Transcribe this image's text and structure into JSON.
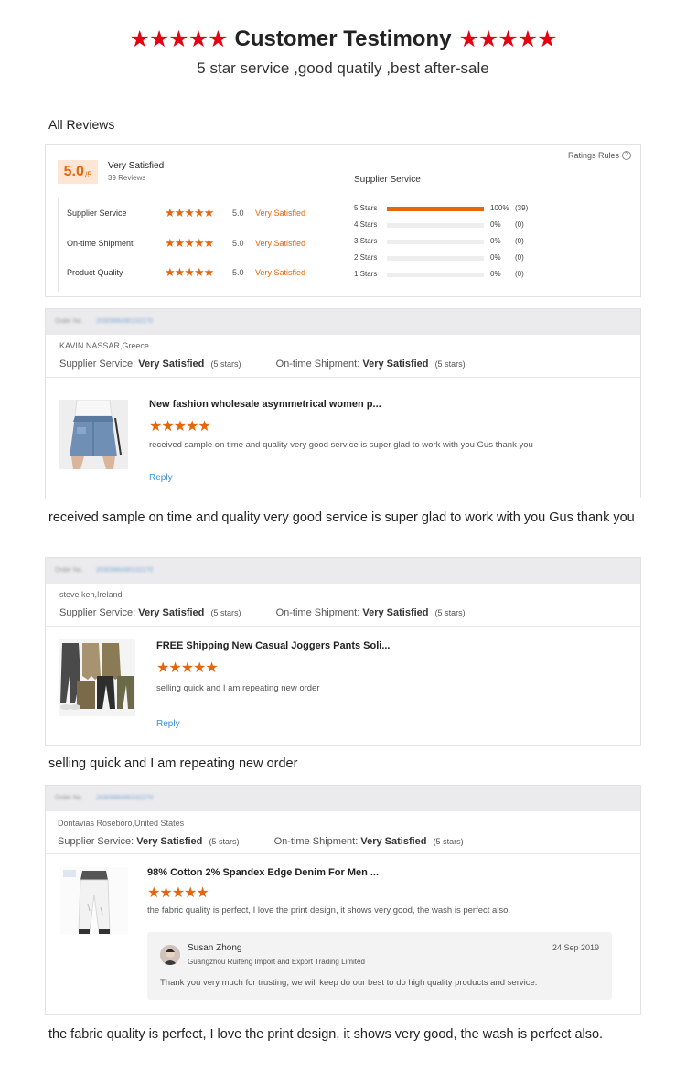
{
  "header": {
    "title": "Customer Testimony",
    "stars": "★★★★★",
    "subtitle": "5 star service ,good quatily ,best after-sale"
  },
  "all_reviews_label": "All Reviews",
  "summary": {
    "ratings_rules": "Ratings Rules",
    "score": "5.0",
    "score_suffix": "/5",
    "overall_label": "Very Satisfied",
    "review_count": "39 Reviews",
    "metrics": [
      {
        "label": "Supplier Service",
        "stars": "★★★★★",
        "value": "5.0",
        "text": "Very Satisfied"
      },
      {
        "label": "On-time Shipment",
        "stars": "★★★★★",
        "value": "5.0",
        "text": "Very Satisfied"
      },
      {
        "label": "Product Quality",
        "stars": "★★★★★",
        "value": "5.0",
        "text": "Very Satisfied"
      }
    ],
    "breakdown_title": "Supplier Service",
    "breakdown": [
      {
        "label": "5 Stars",
        "fraction": 1.0,
        "percent": "100%",
        "count": "(39)"
      },
      {
        "label": "4 Stars",
        "fraction": 0,
        "percent": "0%",
        "count": "(0)"
      },
      {
        "label": "3 Stars",
        "fraction": 0,
        "percent": "0%",
        "count": "(0)"
      },
      {
        "label": "2 Stars",
        "fraction": 0,
        "percent": "0%",
        "count": "(0)"
      },
      {
        "label": "1 Stars",
        "fraction": 0,
        "percent": "0%",
        "count": "(0)"
      }
    ]
  },
  "reviews": [
    {
      "order_label": "Order No.",
      "order_no": "2030986490102270",
      "buyer": "KAVIN NASSAR,Greece",
      "supplier_label": "Supplier Service:",
      "supplier_value": "Very Satisfied",
      "supplier_stars": "(5 stars)",
      "shipment_label": "On-time Shipment:",
      "shipment_value": "Very Satisfied",
      "shipment_stars": "(5 stars)",
      "product_title": "New fashion wholesale asymmetrical women p...",
      "stars": "★★★★★",
      "text": "received sample on time and quality very good service is super glad to work with you Gus thank you",
      "reply": "Reply",
      "caption": "received sample on time and quality very good service is super glad to work with you Gus thank you"
    },
    {
      "order_label": "Order No.",
      "order_no": "2030986490102270",
      "buyer": "steve ken,Ireland",
      "supplier_label": "Supplier Service:",
      "supplier_value": "Very Satisfied",
      "supplier_stars": "(5 stars)",
      "shipment_label": "On-time Shipment:",
      "shipment_value": "Very Satisfied",
      "shipment_stars": "(5 stars)",
      "product_title": "FREE Shipping New Casual Joggers Pants Soli...",
      "stars": "★★★★★",
      "text": "selling quick and I am repeating new order",
      "reply": "Reply",
      "caption": "selling quick and I am repeating new order"
    },
    {
      "order_label": "Order No.",
      "order_no": "2030986490102270",
      "buyer": "Dontavias Roseboro,United States",
      "supplier_label": "Supplier Service:",
      "supplier_value": "Very Satisfied",
      "supplier_stars": "(5 stars)",
      "shipment_label": "On-time Shipment:",
      "shipment_value": "Very Satisfied",
      "shipment_stars": "(5 stars)",
      "product_title": "98% Cotton 2% Spandex Edge Denim For Men ...",
      "stars": "★★★★★",
      "text": "the fabric quality is perfect, I love the print design, it shows very good, the wash is perfect also.",
      "seller_reply": {
        "name": "Susan Zhong",
        "company": "Guangzhou Ruifeng Import and Export Trading Limited",
        "date": "24 Sep 2019",
        "message": "Thank you very much for trusting, we will keep do our best to do high quality products and service."
      },
      "caption": "the fabric quality is perfect, I love the print design, it shows very good, the wash is perfect also."
    }
  ],
  "colors": {
    "accent_orange": "#e8650a",
    "title_star_red": "#e60012",
    "link_blue": "#3a8fd9"
  }
}
